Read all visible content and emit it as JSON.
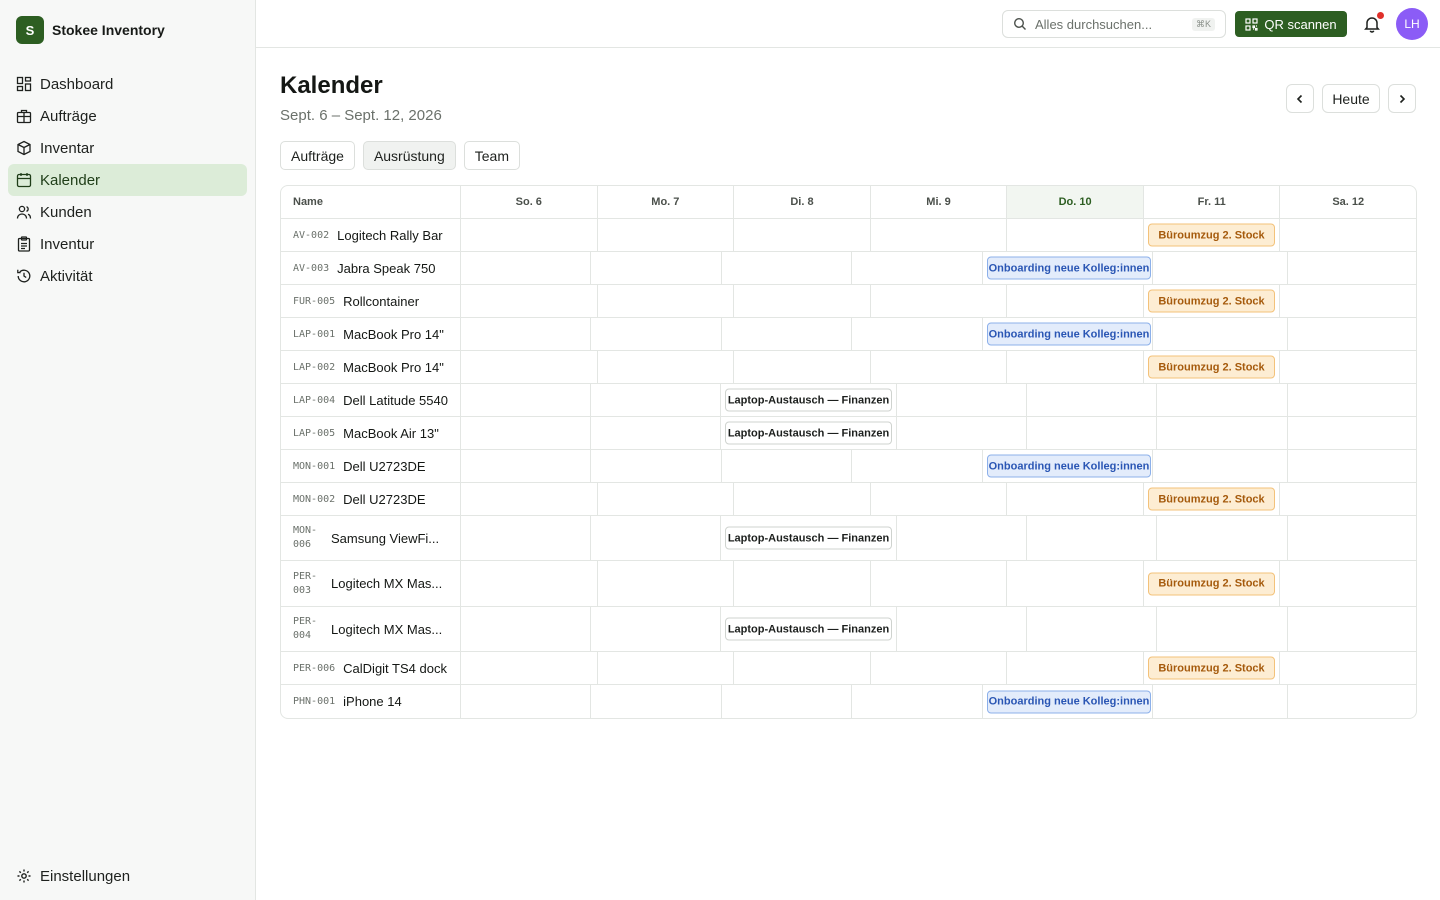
{
  "app": {
    "logo_letter": "S",
    "name": "Stokee Inventory"
  },
  "nav": {
    "items": [
      {
        "label": "Dashboard",
        "icon": "dashboard-icon"
      },
      {
        "label": "Aufträge",
        "icon": "orders-icon"
      },
      {
        "label": "Inventar",
        "icon": "box-icon"
      },
      {
        "label": "Kalender",
        "icon": "calendar-icon",
        "active": true
      },
      {
        "label": "Kunden",
        "icon": "users-icon"
      },
      {
        "label": "Inventur",
        "icon": "clipboard-icon"
      },
      {
        "label": "Aktivität",
        "icon": "history-icon"
      }
    ],
    "settings_label": "Einstellungen"
  },
  "topbar": {
    "search_placeholder": "Alles durchsuchen...",
    "search_shortcut": "⌘K",
    "qr_label": "QR scannen",
    "avatar_initials": "LH"
  },
  "header": {
    "title": "Kalender",
    "range": "Sept. 6 – Sept. 12, 2026",
    "today_label": "Heute"
  },
  "view_tabs": [
    {
      "label": "Aufträge"
    },
    {
      "label": "Ausrüstung",
      "active": true
    },
    {
      "label": "Team"
    }
  ],
  "calendar": {
    "name_header": "Name",
    "days": [
      "So. 6",
      "Mo. 7",
      "Di. 8",
      "Mi. 9",
      "Do. 10",
      "Fr. 11",
      "Sa. 12"
    ],
    "today_index": 4,
    "events": {
      "buro": "Büroumzug 2. Stock",
      "onb": "Onboarding neue Kolleg:innen",
      "lap": "Laptop-Austausch — Finanzen"
    },
    "colors": {
      "orange": "#fdedd3",
      "blue": "#e3ecfb",
      "accent": "#2d5e22"
    },
    "rows": [
      {
        "code": "AV-002",
        "name": "Logitech Rally Bar",
        "event": "buro"
      },
      {
        "code": "AV-003",
        "name": "Jabra Speak 750",
        "event": "onb"
      },
      {
        "code": "FUR-005",
        "name": "Rollcontainer",
        "event": "buro"
      },
      {
        "code": "LAP-001",
        "name": "MacBook Pro 14\"",
        "event": "onb"
      },
      {
        "code": "LAP-002",
        "name": "MacBook Pro 14\"",
        "event": "buro"
      },
      {
        "code": "LAP-004",
        "name": "Dell Latitude 5540",
        "event": "lap"
      },
      {
        "code": "LAP-005",
        "name": "MacBook Air 13\"",
        "event": "lap"
      },
      {
        "code": "MON-001",
        "name": "Dell U2723DE",
        "event": "onb"
      },
      {
        "code": "MON-002",
        "name": "Dell U2723DE",
        "event": "buro"
      },
      {
        "code": "MON-006",
        "name": "Samsung ViewFi...",
        "event": "lap",
        "wrap": true
      },
      {
        "code": "PER-003",
        "name": "Logitech MX Mas...",
        "event": "buro",
        "wrap": true
      },
      {
        "code": "PER-004",
        "name": "Logitech MX Mas...",
        "event": "lap",
        "wrap": true
      },
      {
        "code": "PER-006",
        "name": "CalDigit TS4 dock",
        "event": "buro"
      },
      {
        "code": "PHN-001",
        "name": "iPhone 14",
        "event": "onb"
      }
    ]
  }
}
